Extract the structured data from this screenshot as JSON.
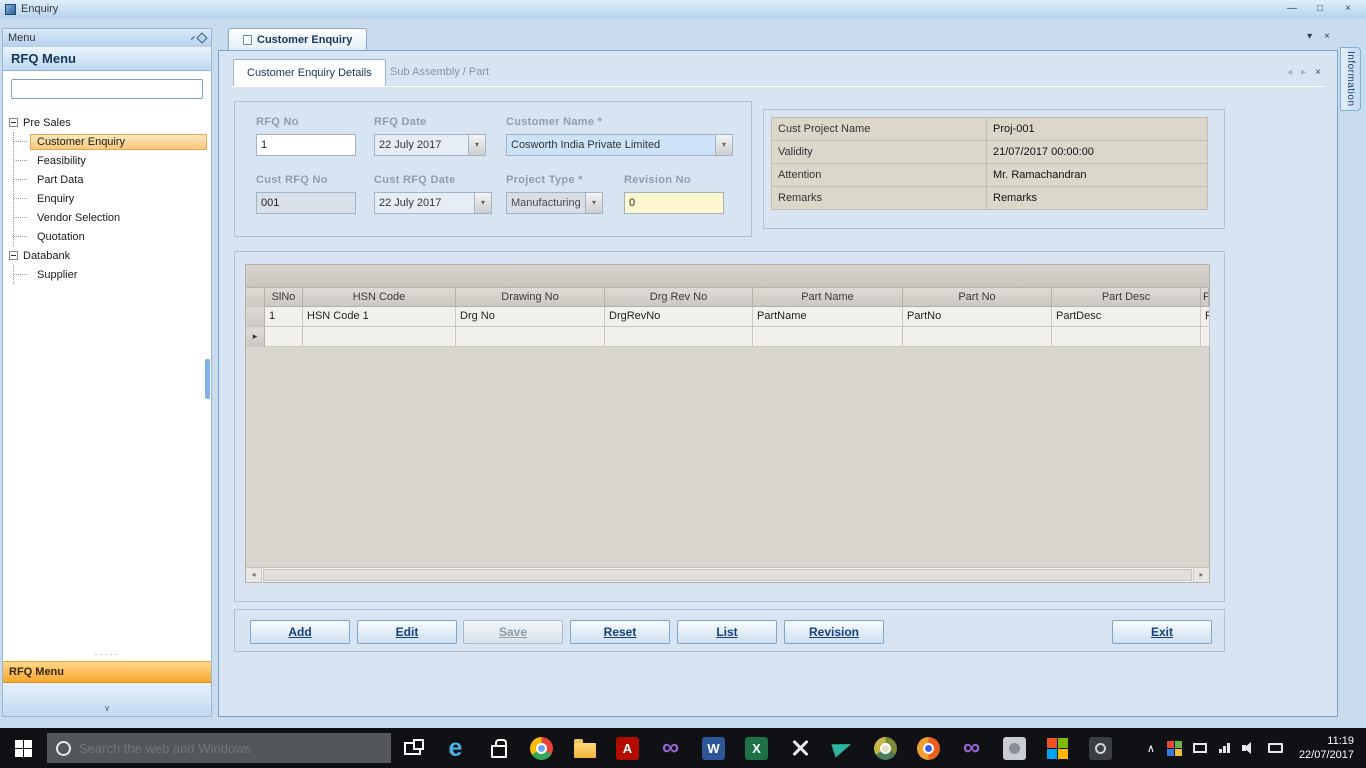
{
  "window": {
    "title": "Enquiry"
  },
  "icons": {
    "minimize": "—",
    "maximize": "□",
    "close": "×",
    "dropdown": "▾",
    "nav_left": "◂",
    "nav_right": "▸",
    "chevron_up": "∧",
    "chevron_down": "∨",
    "row_marker": "▸",
    "scroll_left": "◂",
    "scroll_right": "▸",
    "grip_dots": "·····",
    "edge": "e",
    "acrobat": "A",
    "word": "W",
    "excel": "X",
    "visual_studio": "∞"
  },
  "sidebar": {
    "caption": "Menu",
    "title": "RFQ Menu",
    "search_value": "",
    "tree": [
      {
        "label": "Pre Sales"
      },
      {
        "label": "Customer Enquiry"
      },
      {
        "label": "Feasibility"
      },
      {
        "label": "Part Data"
      },
      {
        "label": "Enquiry"
      },
      {
        "label": "Vendor Selection"
      },
      {
        "label": "Quotation"
      },
      {
        "label": "Databank"
      },
      {
        "label": "Supplier"
      }
    ],
    "bottom_bar": "RFQ Menu"
  },
  "tabs": {
    "document": "Customer Enquiry",
    "detail": "Customer Enquiry Details",
    "sub": "Sub Assembly / Part",
    "side": "Information"
  },
  "form": {
    "rfq_no": {
      "label": "RFQ No",
      "value": "1"
    },
    "rfq_date": {
      "label": "RFQ Date",
      "value": "22 July 2017"
    },
    "customer_name": {
      "label": "Customer Name *",
      "value": "Cosworth India Private Limited"
    },
    "cust_rfq_no": {
      "label": "Cust RFQ No",
      "value": "001"
    },
    "cust_rfq_date": {
      "label": "Cust RFQ Date",
      "value": "22 July 2017"
    },
    "project_type": {
      "label": "Project Type *",
      "value": "Manufacturing"
    },
    "revision_no": {
      "label": "Revision No",
      "value": "0"
    }
  },
  "info": {
    "rows": [
      {
        "label": "Cust Project Name",
        "value": "Proj-001"
      },
      {
        "label": "Validity",
        "value": "21/07/2017 00:00:00"
      },
      {
        "label": "Attention",
        "value": "Mr. Ramachandran"
      },
      {
        "label": "Remarks",
        "value": "Remarks"
      }
    ]
  },
  "grid": {
    "columns": [
      "SlNo",
      "HSN Code",
      "Drawing No",
      "Drg Rev No",
      "Part Name",
      "Part No",
      "Part Desc",
      "P"
    ],
    "rows": [
      {
        "cells": [
          "1",
          "HSN Code 1",
          "Drg No",
          "DrgRevNo",
          "PartName",
          "PartNo",
          "PartDesc",
          "P"
        ]
      }
    ]
  },
  "actions": [
    {
      "label": "Add"
    },
    {
      "label": "Edit"
    },
    {
      "label": "Save"
    },
    {
      "label": "Reset"
    },
    {
      "label": "List"
    },
    {
      "label": "Revision"
    },
    {
      "label": "Exit"
    }
  ],
  "taskbar": {
    "search_placeholder": "Search the web and Windows",
    "time": "11:19",
    "date": "22/07/2017"
  }
}
